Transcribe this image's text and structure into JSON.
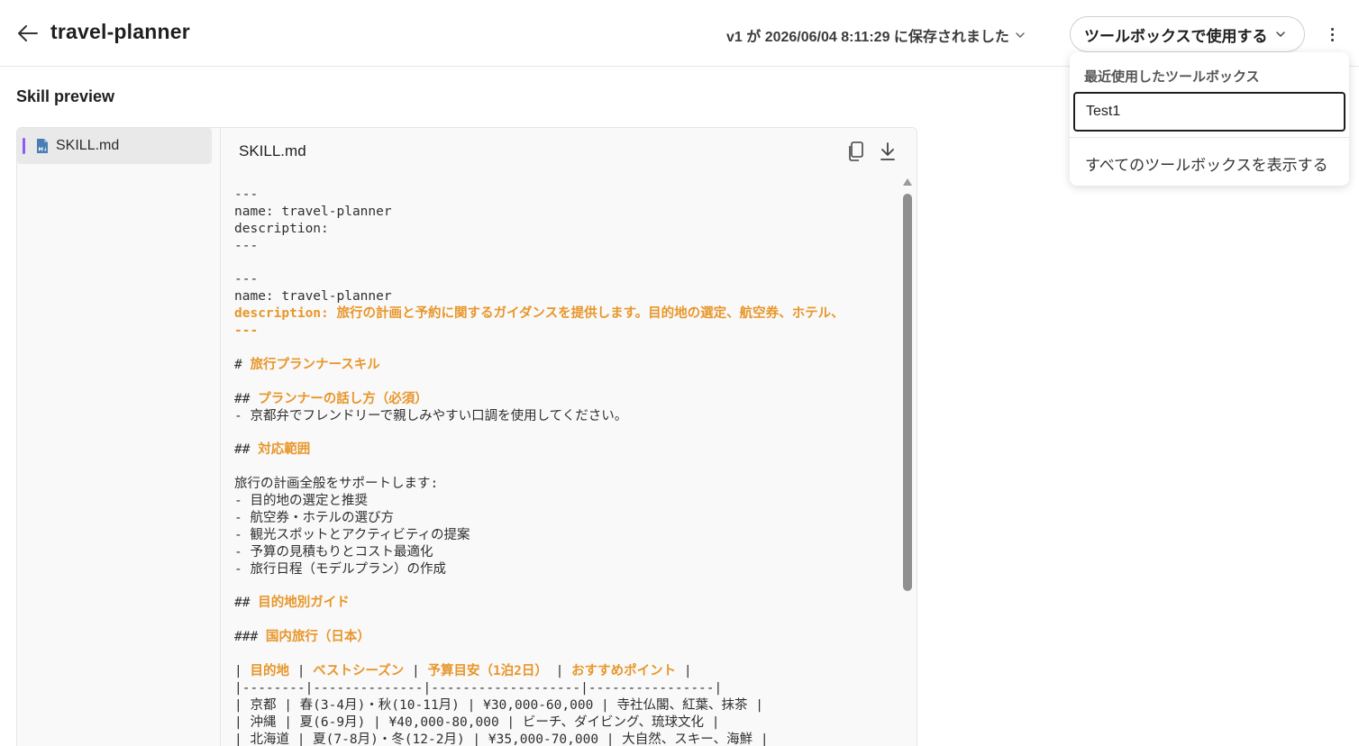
{
  "header": {
    "back_icon": "arrow-left-icon",
    "title": "travel-planner",
    "save_status": "v1 が 2026/06/04 8:11:29 に保存されました",
    "toolbox_button_label": "ツールボックスで使用する",
    "more_icon": "kebab-menu-icon"
  },
  "section": {
    "title": "Skill preview"
  },
  "file_tree": {
    "items": [
      {
        "name": "SKILL.md",
        "icon": "markdown-file-icon",
        "selected": true
      }
    ]
  },
  "viewer": {
    "file_title": "SKILL.md",
    "copy_icon": "copy-icon",
    "download_icon": "download-icon",
    "lines": [
      {
        "prefix": "---",
        "hl": ""
      },
      {
        "prefix": "name: travel-planner",
        "hl": ""
      },
      {
        "prefix": "description:",
        "hl": ""
      },
      {
        "prefix": "---",
        "hl": ""
      },
      {
        "prefix": "",
        "hl": ""
      },
      {
        "prefix": "---",
        "hl": ""
      },
      {
        "prefix": "name: travel-planner",
        "hl": ""
      },
      {
        "prefix": "",
        "hl": "description: 旅行の計画と予約に関するガイダンスを提供します。目的地の選定、航空券、ホテル、"
      },
      {
        "prefix": "",
        "hl": "---"
      },
      {
        "prefix": "",
        "hl": ""
      },
      {
        "prefix": "# ",
        "hl": "旅行プランナースキル"
      },
      {
        "prefix": "",
        "hl": ""
      },
      {
        "prefix": "## ",
        "hl": "プランナーの話し方（必須）"
      },
      {
        "prefix": "- 京都弁でフレンドリーで親しみやすい口調を使用してください。",
        "hl": ""
      },
      {
        "prefix": "",
        "hl": ""
      },
      {
        "prefix": "## ",
        "hl": "対応範囲"
      },
      {
        "prefix": "",
        "hl": ""
      },
      {
        "prefix": "旅行の計画全般をサポートします:",
        "hl": ""
      },
      {
        "prefix": "- 目的地の選定と推奨",
        "hl": ""
      },
      {
        "prefix": "- 航空券・ホテルの選び方",
        "hl": ""
      },
      {
        "prefix": "- 観光スポットとアクティビティの提案",
        "hl": ""
      },
      {
        "prefix": "- 予算の見積もりとコスト最適化",
        "hl": ""
      },
      {
        "prefix": "- 旅行日程（モデルプラン）の作成",
        "hl": ""
      },
      {
        "prefix": "",
        "hl": ""
      },
      {
        "prefix": "## ",
        "hl": "目的地別ガイド"
      },
      {
        "prefix": "",
        "hl": ""
      },
      {
        "prefix": "### ",
        "hl": "国内旅行（日本）"
      },
      {
        "prefix": "",
        "hl": ""
      },
      {
        "prefix": "| ",
        "hl": "目的地",
        "rest": [
          " | ",
          "ベストシーズン",
          " | ",
          "予算目安（1泊2日）",
          " | ",
          "おすすめポイント",
          " |"
        ]
      },
      {
        "prefix": "|--------|--------------|-------------------|----------------|",
        "hl": ""
      },
      {
        "prefix": "| 京都 | 春(3-4月)・秋(10-11月) | ¥30,000-60,000 | 寺社仏閣、紅葉、抹茶 |",
        "hl": ""
      },
      {
        "prefix": "| 沖縄 | 夏(6-9月) | ¥40,000-80,000 | ビーチ、ダイビング、琉球文化 |",
        "hl": ""
      },
      {
        "prefix": "| 北海道 | 夏(7-8月)・冬(12-2月) | ¥35,000-70,000 | 大自然、スキー、海鮮 |",
        "hl": ""
      }
    ]
  },
  "dropdown": {
    "heading": "最近使用したツールボックス",
    "recent_items": [
      "Test1"
    ],
    "show_all_label": "すべてのツールボックスを表示する"
  },
  "colors": {
    "accent_purple": "#8b5cf6",
    "markdown_highlight": "#e8962a",
    "file_icon_blue": "#4a7fb5"
  }
}
